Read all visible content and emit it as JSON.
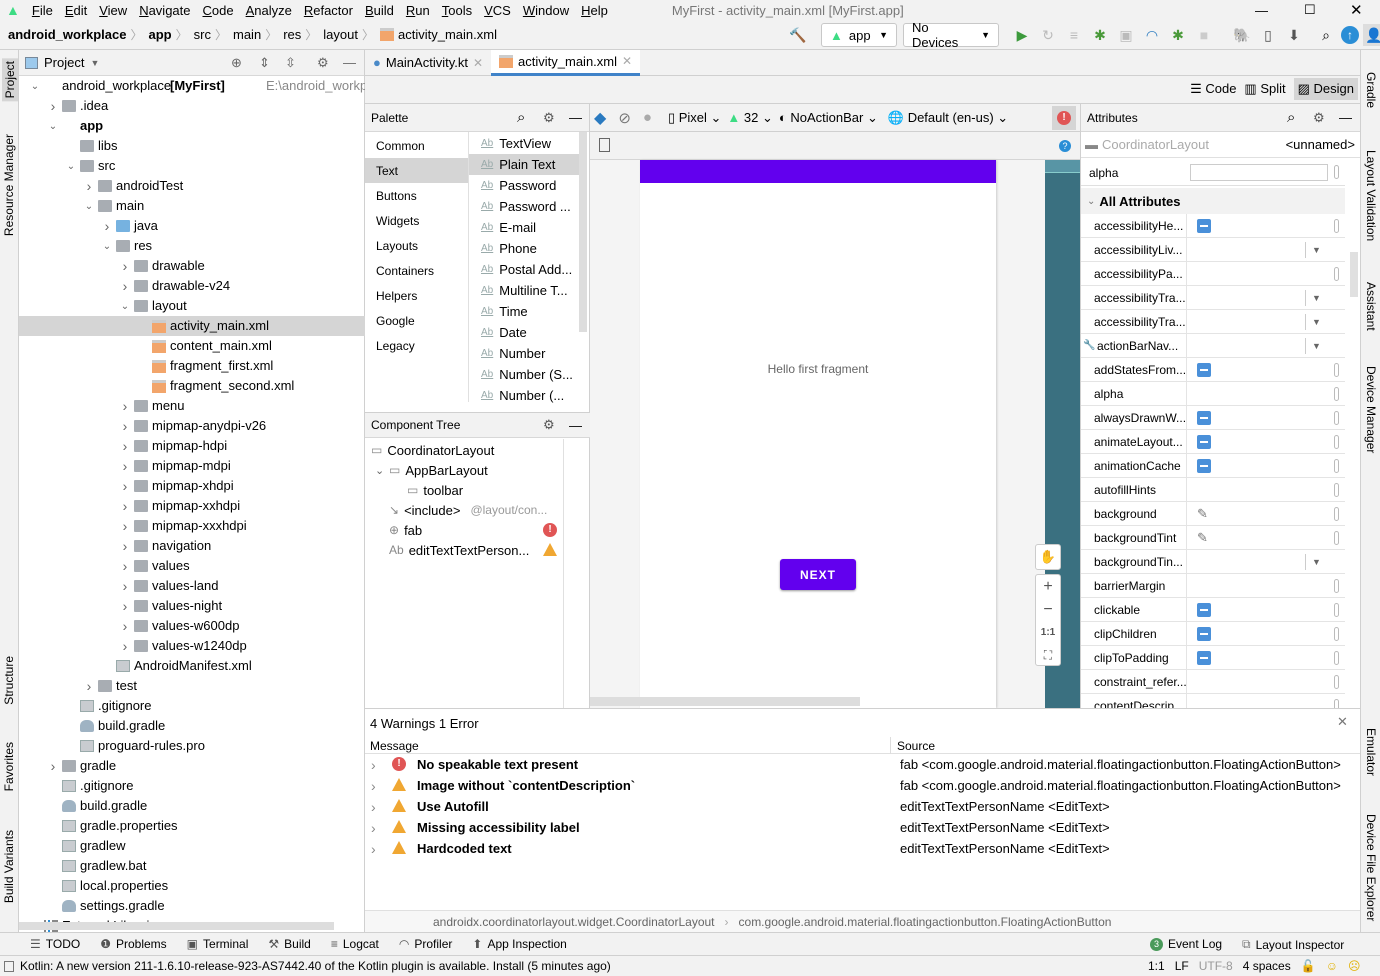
{
  "menubar": {
    "items": [
      "File",
      "Edit",
      "View",
      "Navigate",
      "Code",
      "Analyze",
      "Refactor",
      "Build",
      "Run",
      "Tools",
      "VCS",
      "Window",
      "Help"
    ],
    "title": "MyFirst - activity_main.xml [MyFirst.app]"
  },
  "navbar": {
    "crumbs": [
      "android_workplace",
      "app",
      "src",
      "main",
      "res",
      "layout",
      "activity_main.xml"
    ],
    "run_config": "app",
    "device": "No Devices"
  },
  "project": {
    "header": "Project",
    "tree": [
      {
        "label": "android_workplace",
        "bold_suffix": "[MyFirst]",
        "hint": "E:\\android_workplace",
        "level": 0,
        "arrow": "open",
        "icon": "mod"
      },
      {
        "label": ".idea",
        "level": 1,
        "arrow": "closed",
        "icon": "folder"
      },
      {
        "label": "app",
        "level": 1,
        "arrow": "open",
        "icon": "mod",
        "bold": true
      },
      {
        "label": "libs",
        "level": 2,
        "icon": "folder"
      },
      {
        "label": "src",
        "level": 2,
        "arrow": "open",
        "icon": "folder"
      },
      {
        "label": "androidTest",
        "level": 3,
        "arrow": "closed",
        "icon": "folder"
      },
      {
        "label": "main",
        "level": 3,
        "arrow": "open",
        "icon": "folder"
      },
      {
        "label": "java",
        "level": 4,
        "arrow": "closed",
        "icon": "src"
      },
      {
        "label": "res",
        "level": 4,
        "arrow": "open",
        "icon": "folder"
      },
      {
        "label": "drawable",
        "level": 5,
        "arrow": "closed",
        "icon": "folder"
      },
      {
        "label": "drawable-v24",
        "level": 5,
        "arrow": "closed",
        "icon": "folder"
      },
      {
        "label": "layout",
        "level": 5,
        "arrow": "open",
        "icon": "folder"
      },
      {
        "label": "activity_main.xml",
        "level": 6,
        "icon": "xml",
        "selected": true
      },
      {
        "label": "content_main.xml",
        "level": 6,
        "icon": "xml"
      },
      {
        "label": "fragment_first.xml",
        "level": 6,
        "icon": "xml"
      },
      {
        "label": "fragment_second.xml",
        "level": 6,
        "icon": "xml"
      },
      {
        "label": "menu",
        "level": 5,
        "arrow": "closed",
        "icon": "folder"
      },
      {
        "label": "mipmap-anydpi-v26",
        "level": 5,
        "arrow": "closed",
        "icon": "folder"
      },
      {
        "label": "mipmap-hdpi",
        "level": 5,
        "arrow": "closed",
        "icon": "folder"
      },
      {
        "label": "mipmap-mdpi",
        "level": 5,
        "arrow": "closed",
        "icon": "folder"
      },
      {
        "label": "mipmap-xhdpi",
        "level": 5,
        "arrow": "closed",
        "icon": "folder"
      },
      {
        "label": "mipmap-xxhdpi",
        "level": 5,
        "arrow": "closed",
        "icon": "folder"
      },
      {
        "label": "mipmap-xxxhdpi",
        "level": 5,
        "arrow": "closed",
        "icon": "folder"
      },
      {
        "label": "navigation",
        "level": 5,
        "arrow": "closed",
        "icon": "folder"
      },
      {
        "label": "values",
        "level": 5,
        "arrow": "closed",
        "icon": "folder"
      },
      {
        "label": "values-land",
        "level": 5,
        "arrow": "closed",
        "icon": "folder"
      },
      {
        "label": "values-night",
        "level": 5,
        "arrow": "closed",
        "icon": "folder"
      },
      {
        "label": "values-w600dp",
        "level": 5,
        "arrow": "closed",
        "icon": "folder"
      },
      {
        "label": "values-w1240dp",
        "level": 5,
        "arrow": "closed",
        "icon": "folder"
      },
      {
        "label": "AndroidManifest.xml",
        "level": 4,
        "icon": "file"
      },
      {
        "label": "test",
        "level": 3,
        "arrow": "closed",
        "icon": "folder"
      },
      {
        "label": ".gitignore",
        "level": 2,
        "icon": "file"
      },
      {
        "label": "build.gradle",
        "level": 2,
        "icon": "gradle"
      },
      {
        "label": "proguard-rules.pro",
        "level": 2,
        "icon": "file"
      },
      {
        "label": "gradle",
        "level": 1,
        "arrow": "closed",
        "icon": "folder"
      },
      {
        "label": ".gitignore",
        "level": 1,
        "icon": "file"
      },
      {
        "label": "build.gradle",
        "level": 1,
        "icon": "gradle"
      },
      {
        "label": "gradle.properties",
        "level": 1,
        "icon": "file"
      },
      {
        "label": "gradlew",
        "level": 1,
        "icon": "file"
      },
      {
        "label": "gradlew.bat",
        "level": 1,
        "icon": "file"
      },
      {
        "label": "local.properties",
        "level": 1,
        "icon": "file"
      },
      {
        "label": "settings.gradle",
        "level": 1,
        "icon": "gradle"
      },
      {
        "label": "External Libraries",
        "level": 0,
        "arrow": "closed",
        "icon": "lib"
      }
    ]
  },
  "left_strip": [
    "Project",
    "Resource Manager",
    "Structure",
    "Favorites",
    "Build Variants"
  ],
  "right_strip": [
    "Gradle",
    "Layout Validation",
    "Assistant",
    "Device Manager",
    "Emulator",
    "Device File Explorer"
  ],
  "tabs": [
    {
      "label": "MainActivity.kt",
      "active": false
    },
    {
      "label": "activity_main.xml",
      "active": true
    }
  ],
  "modes": {
    "code": "Code",
    "split": "Split",
    "design": "Design",
    "active": "Design"
  },
  "palette": {
    "header": "Palette",
    "categories": [
      "Common",
      "Text",
      "Buttons",
      "Widgets",
      "Layouts",
      "Containers",
      "Helpers",
      "Google",
      "Legacy"
    ],
    "selected_category": "Text",
    "items": [
      "TextView",
      "Plain Text",
      "Password",
      "Password ...",
      "E-mail",
      "Phone",
      "Postal Add...",
      "Multiline T...",
      "Time",
      "Date",
      "Number",
      "Number (S...",
      "Number (..."
    ],
    "selected_item": "Plain Text"
  },
  "component_tree": {
    "header": "Component Tree",
    "nodes": [
      {
        "label": "CoordinatorLayout",
        "level": 0
      },
      {
        "label": "AppBarLayout",
        "level": 1,
        "arrow": "open"
      },
      {
        "label": "toolbar",
        "level": 2
      },
      {
        "label": "<include>",
        "hint": "@layout/con...",
        "level": 1
      },
      {
        "label": "fab",
        "level": 1,
        "status": "error"
      },
      {
        "label": "editTextTextPerson...",
        "level": 1,
        "status": "warning"
      }
    ]
  },
  "designbar": {
    "device": "Pixel",
    "api": "32",
    "theme": "NoActionBar",
    "locale": "Default (en-us)"
  },
  "canvas": {
    "text": "Hello first fragment",
    "button": "NEXT",
    "accent": "#6200ee",
    "zoom_fit": "1:1"
  },
  "attributes": {
    "header": "Attributes",
    "component": "CoordinatorLayout",
    "id": "<unnamed>",
    "alpha_label": "alpha",
    "section": "All Attributes",
    "rows": [
      {
        "name": "accessibilityHe...",
        "control": "flag"
      },
      {
        "name": "accessibilityLiv...",
        "control": "dropdown"
      },
      {
        "name": "accessibilityPa...",
        "control": "empty"
      },
      {
        "name": "accessibilityTra...",
        "control": "dropdown"
      },
      {
        "name": "accessibilityTra...",
        "control": "dropdown"
      },
      {
        "name": "actionBarNav...",
        "control": "dropdown",
        "wrench": true
      },
      {
        "name": "addStatesFrom...",
        "control": "flag"
      },
      {
        "name": "alpha",
        "control": "empty"
      },
      {
        "name": "alwaysDrawnW...",
        "control": "flag"
      },
      {
        "name": "animateLayout...",
        "control": "flag"
      },
      {
        "name": "animationCache",
        "control": "flag"
      },
      {
        "name": "autofillHints",
        "control": "empty"
      },
      {
        "name": "background",
        "control": "picker"
      },
      {
        "name": "backgroundTint",
        "control": "picker"
      },
      {
        "name": "backgroundTin...",
        "control": "dropdown"
      },
      {
        "name": "barrierMargin",
        "control": "empty"
      },
      {
        "name": "clickable",
        "control": "flag"
      },
      {
        "name": "clipChildren",
        "control": "flag"
      },
      {
        "name": "clipToPadding",
        "control": "flag"
      },
      {
        "name": "constraint_refer...",
        "control": "empty"
      },
      {
        "name": "contentDescrip...",
        "control": "empty"
      }
    ]
  },
  "problems": {
    "title": "4 Warnings 1 Error",
    "col_message": "Message",
    "col_source": "Source",
    "rows": [
      {
        "severity": "error",
        "message": "No speakable text present",
        "source": "fab <com.google.android.material.floatingactionbutton.FloatingActionButton>"
      },
      {
        "severity": "warning",
        "message": "Image without `contentDescription`",
        "source": "fab <com.google.android.material.floatingactionbutton.FloatingActionButton>"
      },
      {
        "severity": "warning",
        "message": "Use Autofill",
        "source": "editTextTextPersonName <EditText>"
      },
      {
        "severity": "warning",
        "message": "Missing accessibility label",
        "source": "editTextTextPersonName <EditText>"
      },
      {
        "severity": "warning",
        "message": "Hardcoded text",
        "source": "editTextTextPersonName <EditText>"
      }
    ],
    "breadcrumb": [
      "androidx.coordinatorlayout.widget.CoordinatorLayout",
      "com.google.android.material.floatingactionbutton.FloatingActionButton"
    ]
  },
  "bottom_tabs": [
    "TODO",
    "Problems",
    "Terminal",
    "Build",
    "Logcat",
    "Profiler",
    "App Inspection"
  ],
  "bottom_right": {
    "event_log": "Event Log",
    "event_count": "3",
    "layout_inspector": "Layout Inspector"
  },
  "status": {
    "message": "Kotlin: A new version 211-1.6.10-release-923-AS7442.40 of the Kotlin plugin is available. Install (5 minutes ago)",
    "position": "1:1",
    "line_sep": "LF",
    "encoding": "UTF-8",
    "indent": "4 spaces"
  }
}
